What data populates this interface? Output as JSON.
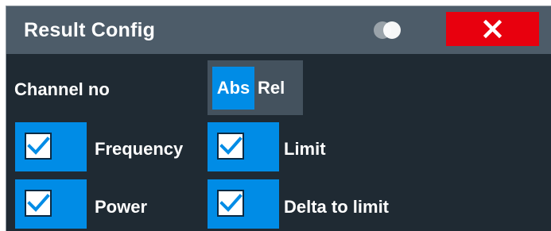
{
  "dialog": {
    "title": "Result Config",
    "transparency_icon": "transparency-toggle-icon",
    "close_icon": "close-x-icon",
    "colors": {
      "titlebar": "#4d5c69",
      "background": "#1f2a33",
      "accent": "#008ce6",
      "close": "#e8000e"
    }
  },
  "channel_no": {
    "label": "Channel no",
    "options": [
      "Abs",
      "Rel"
    ],
    "selected": "Abs"
  },
  "checkboxes": [
    {
      "label": "Frequency",
      "checked": true
    },
    {
      "label": "Limit",
      "checked": true
    },
    {
      "label": "Power",
      "checked": true
    },
    {
      "label": "Delta to limit",
      "checked": true
    }
  ]
}
